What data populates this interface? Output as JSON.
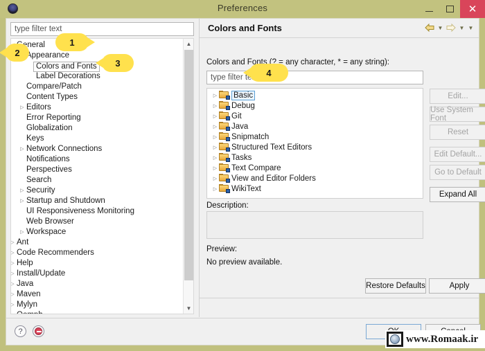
{
  "window": {
    "title": "Preferences",
    "app_icon": "eclipse-icon",
    "controls": {
      "minimize": "minimize-icon",
      "maximize": "maximize-icon",
      "close": "close-icon"
    },
    "close_color": "#d9455a",
    "titlebar_color": "#c2c27f"
  },
  "left_pane": {
    "filter": {
      "placeholder": "type filter text",
      "value": ""
    },
    "tree": [
      {
        "label": "General",
        "indent": 0,
        "twisty": "expanded"
      },
      {
        "label": "Appearance",
        "indent": 1,
        "twisty": "expanded"
      },
      {
        "label": "Colors and Fonts",
        "indent": 2,
        "twisty": "none",
        "selected": true
      },
      {
        "label": "Label Decorations",
        "indent": 2,
        "twisty": "none"
      },
      {
        "label": "Compare/Patch",
        "indent": 1,
        "twisty": "none"
      },
      {
        "label": "Content Types",
        "indent": 1,
        "twisty": "none"
      },
      {
        "label": "Editors",
        "indent": 1,
        "twisty": "collapsed"
      },
      {
        "label": "Error Reporting",
        "indent": 1,
        "twisty": "none"
      },
      {
        "label": "Globalization",
        "indent": 1,
        "twisty": "none"
      },
      {
        "label": "Keys",
        "indent": 1,
        "twisty": "none"
      },
      {
        "label": "Network Connections",
        "indent": 1,
        "twisty": "collapsed"
      },
      {
        "label": "Notifications",
        "indent": 1,
        "twisty": "none"
      },
      {
        "label": "Perspectives",
        "indent": 1,
        "twisty": "none"
      },
      {
        "label": "Search",
        "indent": 1,
        "twisty": "none"
      },
      {
        "label": "Security",
        "indent": 1,
        "twisty": "collapsed"
      },
      {
        "label": "Startup and Shutdown",
        "indent": 1,
        "twisty": "collapsed"
      },
      {
        "label": "UI Responsiveness Monitoring",
        "indent": 1,
        "twisty": "none"
      },
      {
        "label": "Web Browser",
        "indent": 1,
        "twisty": "none"
      },
      {
        "label": "Workspace",
        "indent": 1,
        "twisty": "collapsed"
      },
      {
        "label": "Ant",
        "indent": 0,
        "twisty": "collapsed"
      },
      {
        "label": "Code Recommenders",
        "indent": 0,
        "twisty": "collapsed"
      },
      {
        "label": "Help",
        "indent": 0,
        "twisty": "collapsed"
      },
      {
        "label": "Install/Update",
        "indent": 0,
        "twisty": "collapsed"
      },
      {
        "label": "Java",
        "indent": 0,
        "twisty": "collapsed"
      },
      {
        "label": "Maven",
        "indent": 0,
        "twisty": "collapsed"
      },
      {
        "label": "Mylyn",
        "indent": 0,
        "twisty": "collapsed"
      },
      {
        "label": "Oomph",
        "indent": 0,
        "twisty": "collapsed"
      }
    ],
    "scrollbar": {
      "up_icon": "chevron-up-icon",
      "down_icon": "chevron-down-icon"
    }
  },
  "right_pane": {
    "title": "Colors and Fonts",
    "nav": {
      "back_icon": "back-arrow-icon",
      "back_menu_icon": "chevron-down-icon",
      "forward_icon": "forward-arrow-icon",
      "forward_menu_icon": "chevron-down-icon",
      "more_icon": "chevron-down-icon"
    },
    "filter_label": "Colors and Fonts (? = any character, * = any string):",
    "filter": {
      "placeholder": "type filter text",
      "value": ""
    },
    "categories": [
      {
        "label": "Basic",
        "icon": "folder-theme-icon",
        "selected": true
      },
      {
        "label": "Debug",
        "icon": "folder-theme-icon"
      },
      {
        "label": "Git",
        "icon": "folder-theme-icon"
      },
      {
        "label": "Java",
        "icon": "folder-theme-icon"
      },
      {
        "label": "Snipmatch",
        "icon": "folder-theme-icon"
      },
      {
        "label": "Structured Text Editors",
        "icon": "folder-theme-icon"
      },
      {
        "label": "Tasks",
        "icon": "folder-theme-icon"
      },
      {
        "label": "Text Compare",
        "icon": "folder-theme-icon"
      },
      {
        "label": "View and Editor Folders",
        "icon": "folder-theme-icon"
      },
      {
        "label": "WikiText",
        "icon": "folder-theme-icon"
      }
    ],
    "side_buttons": [
      {
        "label": "Edit...",
        "enabled": false
      },
      {
        "label": "Use System Font",
        "enabled": false
      },
      {
        "label": "Reset",
        "enabled": false
      },
      {
        "label": "Edit Default...",
        "enabled": false
      },
      {
        "label": "Go to Default",
        "enabled": false
      },
      {
        "label": "Expand All",
        "enabled": true
      }
    ],
    "description_label": "Description:",
    "description_value": "",
    "preview_label": "Preview:",
    "preview_value": "No preview available.",
    "restore_defaults_label": "Restore Defaults",
    "apply_label": "Apply"
  },
  "bottom_bar": {
    "help_icon": "help-icon",
    "error_icon": "error-icon",
    "ok_label": "OK",
    "cancel_label": "Cancel"
  },
  "callouts": [
    {
      "number": "1"
    },
    {
      "number": "2"
    },
    {
      "number": "3"
    },
    {
      "number": "4"
    }
  ],
  "watermark": {
    "text": "www.Romaak.ir",
    "logo_icon": "globe-logo-icon"
  }
}
